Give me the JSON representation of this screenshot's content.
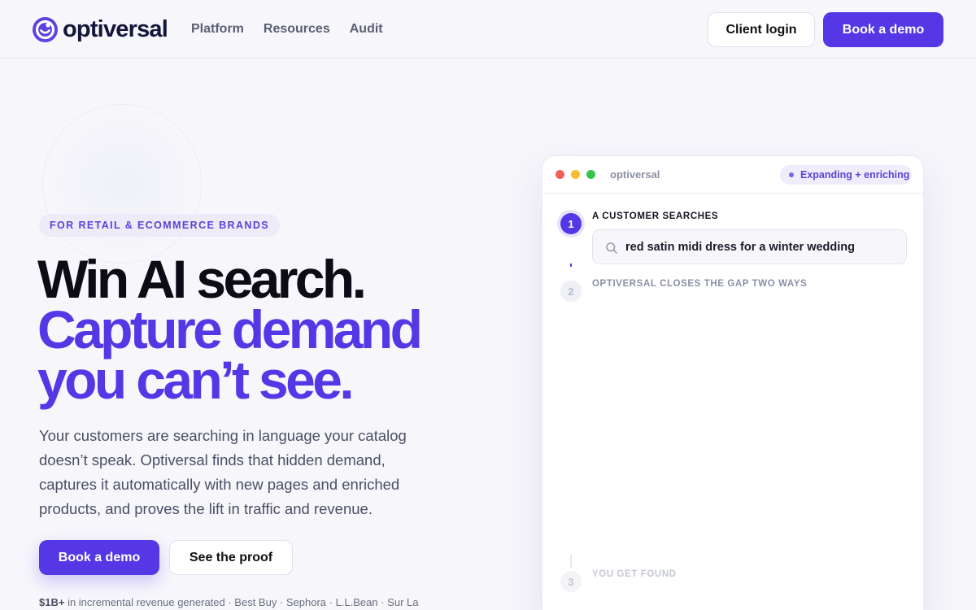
{
  "nav": {
    "brand": "optiversal",
    "links": [
      "Platform",
      "Resources",
      "Audit"
    ],
    "login_label": "Client login",
    "demo_label": "Book a demo"
  },
  "hero": {
    "eyebrow": "FOR RETAIL & ECOMMERCE BRANDS",
    "headline_line1": "Win AI search.",
    "headline_line2": "Capture demand",
    "headline_line3": "you can’t see.",
    "lede": "Your customers are searching in language your catalog doesn’t speak. Optiversal finds that hidden demand, captures it automatically with new pages and enriched products, and proves the lift in traffic and revenue.",
    "primary_cta": "Book a demo",
    "secondary_cta": "See the proof",
    "proof_stat": "$1B+",
    "proof_text": " in incremental revenue generated · Best Buy · Sephora · L.L.Bean · Sur La"
  },
  "demo": {
    "window_title": "optiversal",
    "status": "Expanding + enriching",
    "steps": [
      {
        "num": "1",
        "label": "A CUSTOMER SEARCHES"
      },
      {
        "num": "2",
        "label": "OPTIVERSAL CLOSES THE GAP TWO WAYS"
      },
      {
        "num": "3",
        "label": "YOU GET FOUND"
      }
    ],
    "search_query": "red satin midi dress for a winter wedding"
  },
  "colors": {
    "accent": "#5537e6",
    "background": "#f6f6fb",
    "text_dark": "#0c0d14"
  }
}
